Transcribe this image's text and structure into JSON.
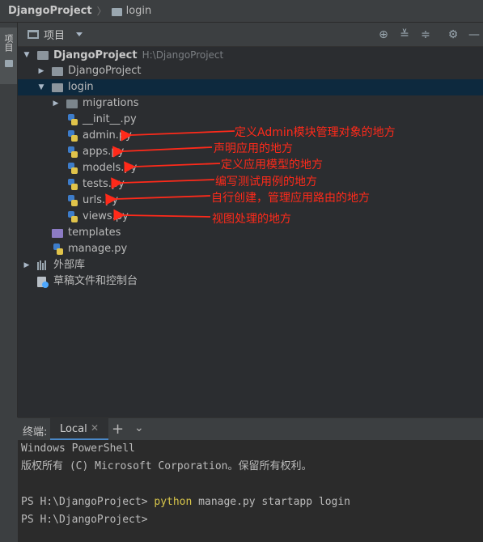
{
  "breadcrumb": {
    "project": "DjangoProject",
    "folder": "login"
  },
  "tool_window": {
    "side_label": "项目",
    "title": "项目"
  },
  "tree": {
    "root": {
      "name": "DjangoProject",
      "path": "H:\\DjangoProject"
    },
    "items": [
      {
        "name": "DjangoProject",
        "kind": "folder"
      },
      {
        "name": "login",
        "kind": "folder",
        "selected": true
      },
      {
        "name": "migrations",
        "kind": "folder"
      },
      {
        "name": "__init__.py",
        "kind": "python"
      },
      {
        "name": "admin.py",
        "kind": "python"
      },
      {
        "name": "apps.py",
        "kind": "python"
      },
      {
        "name": "models.py",
        "kind": "python"
      },
      {
        "name": "tests.py",
        "kind": "python"
      },
      {
        "name": "urls.py",
        "kind": "python"
      },
      {
        "name": "views.py",
        "kind": "python"
      },
      {
        "name": "templates",
        "kind": "folder"
      },
      {
        "name": "manage.py",
        "kind": "python"
      }
    ],
    "external_libraries": "外部库",
    "scratches": "草稿文件和控制台"
  },
  "annotations": {
    "admin": "定义Admin模块管理对象的地方",
    "apps": "声明应用的地方",
    "models": "定义应用模型的地方",
    "tests": "编写测试用例的地方",
    "urls": "自行创建，管理应用路由的地方",
    "views": "视图处理的地方"
  },
  "terminal": {
    "title": "终端:",
    "tab_label": "Local",
    "lines": {
      "l1": "Windows PowerShell",
      "l2": "版权所有 (C) Microsoft Corporation。保留所有权利。",
      "l4_prompt": "PS H:\\DjangoProject> ",
      "l4_cmd_python": "python",
      "l4_cmd_rest": " manage.py startapp login",
      "l5_prompt": "PS H:\\DjangoProject>"
    }
  },
  "colors": {
    "annotation": "#ff2a1a",
    "selection": "#0d293e",
    "command_highlight": "#d6c44a"
  }
}
